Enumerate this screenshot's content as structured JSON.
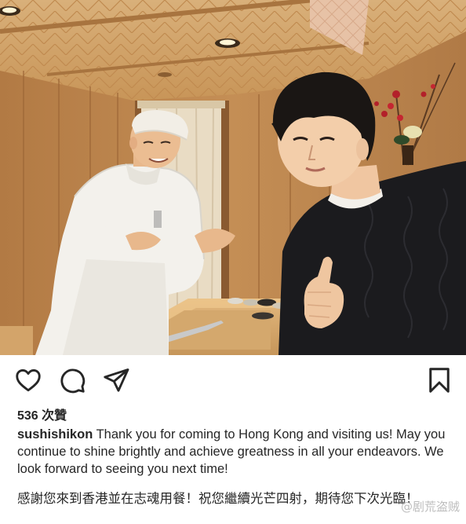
{
  "post": {
    "likes_text": "536 次贊",
    "username": "sushishikon",
    "caption_en": "Thank you for coming to Hong Kong and visiting us! May you continue to shine brightly and achieve greatness in all your endeavors. We look forward to seeing you next time!",
    "caption_zh": "感謝您來到香港並在志魂用餐！祝您繼續光芒四射，期待您下次光臨！"
  },
  "watermark": "@剧荒盗贼",
  "icons": {
    "like": "heart-icon",
    "comment": "comment-icon",
    "share": "paper-plane-icon",
    "save": "bookmark-icon"
  }
}
